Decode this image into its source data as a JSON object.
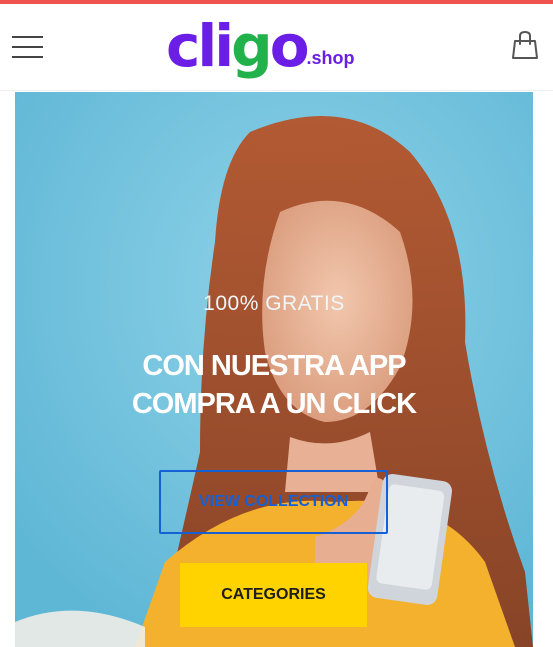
{
  "header": {
    "logo": {
      "part1": "cli",
      "part2": "g",
      "part3": "o",
      "suffix": ".shop"
    },
    "menu_icon": "hamburger-menu-icon",
    "cart_icon": "shopping-bag-icon"
  },
  "hero": {
    "subtitle": "100% GRATIS",
    "title_line1": "CON NUESTRA APP",
    "title_line2": "COMPRA A UN CLICK",
    "primary_button": "VIEW COLLECTION",
    "secondary_button": "CATEGORIES"
  },
  "colors": {
    "brand_purple": "#6a1ee6",
    "brand_green": "#21b24b",
    "hero_background": "#6ec2de",
    "button_outline": "#1660d6",
    "button_yellow": "#ffd300",
    "top_line": "#ef5350"
  }
}
